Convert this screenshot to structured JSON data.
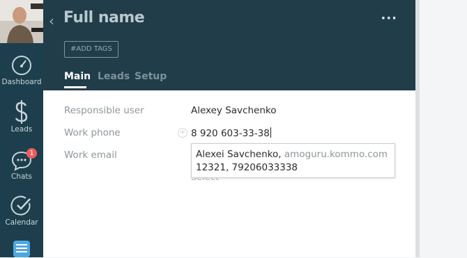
{
  "sidebar": {
    "items": [
      {
        "label": "Dashboard",
        "icon": "speedometer-icon"
      },
      {
        "label": "Leads",
        "icon": "dollar-icon"
      },
      {
        "label": "Chats",
        "icon": "chat-bubble-icon",
        "badge": "1"
      },
      {
        "label": "Calendar",
        "icon": "checkmark-circle-icon"
      },
      {
        "label": "",
        "icon": "lists-icon"
      }
    ]
  },
  "header": {
    "back_icon": "chevron-left-icon",
    "title": "Full name",
    "more_icon": "more-dots-icon",
    "more_label": "···",
    "tags_button": "#ADD TAGS",
    "tabs": [
      {
        "label": "Main",
        "active": true
      },
      {
        "label": "Leads",
        "active": false
      },
      {
        "label": "Setup",
        "active": false
      }
    ]
  },
  "fields": {
    "responsible_user": {
      "label": "Responsible user",
      "value": "Alexey Savchenko"
    },
    "work_phone": {
      "label": "Work phone",
      "value": "8 920 603-33-38"
    },
    "work_email": {
      "label": "Work email",
      "value": ""
    },
    "select_text": "Select ˅"
  },
  "suggestion": {
    "name": "Alexei Savchenko,",
    "domain": " amoguru.kommo.com",
    "details": "12321, 79206033338"
  },
  "colors": {
    "sidebar": "#1d3f4d",
    "header": "#213d4a",
    "badge": "#f05a5a"
  }
}
